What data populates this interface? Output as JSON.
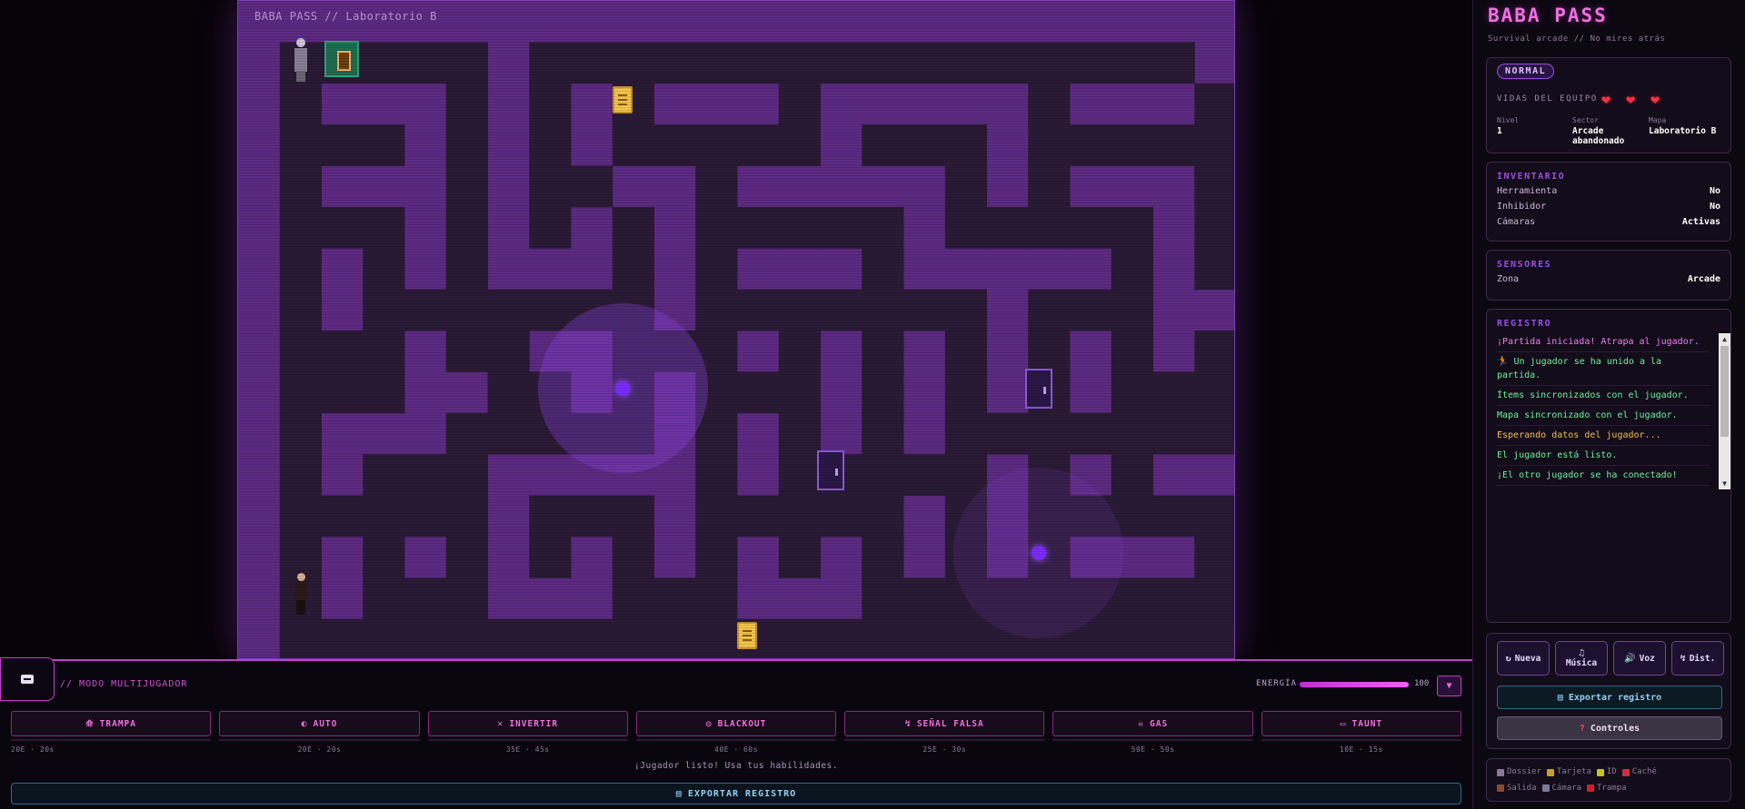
{
  "maze": {
    "title": "BABA PASS // Laboratorio B",
    "cols": 24,
    "rows": 16,
    "open_color": "#2a1a35",
    "wall_color": "#5c2a82",
    "open_cells": [
      [
        1,
        1
      ],
      [
        2,
        1
      ],
      [
        3,
        1
      ],
      [
        4,
        1
      ],
      [
        5,
        1
      ],
      [
        7,
        1
      ],
      [
        8,
        1
      ],
      [
        9,
        1
      ],
      [
        10,
        1
      ],
      [
        11,
        1
      ],
      [
        12,
        1
      ],
      [
        13,
        1
      ],
      [
        14,
        1
      ],
      [
        15,
        1
      ],
      [
        16,
        1
      ],
      [
        17,
        1
      ],
      [
        18,
        1
      ],
      [
        19,
        1
      ],
      [
        20,
        1
      ],
      [
        21,
        1
      ],
      [
        22,
        1
      ],
      [
        1,
        2
      ],
      [
        5,
        2
      ],
      [
        7,
        2
      ],
      [
        9,
        2
      ],
      [
        13,
        2
      ],
      [
        19,
        2
      ],
      [
        23,
        2
      ],
      [
        1,
        3
      ],
      [
        2,
        3
      ],
      [
        3,
        3
      ],
      [
        5,
        3
      ],
      [
        7,
        3
      ],
      [
        9,
        3
      ],
      [
        10,
        3
      ],
      [
        11,
        3
      ],
      [
        12,
        3
      ],
      [
        13,
        3
      ],
      [
        15,
        3
      ],
      [
        16,
        3
      ],
      [
        17,
        3
      ],
      [
        19,
        3
      ],
      [
        20,
        3
      ],
      [
        21,
        3
      ],
      [
        22,
        3
      ],
      [
        23,
        3
      ],
      [
        1,
        4
      ],
      [
        5,
        4
      ],
      [
        7,
        4
      ],
      [
        8,
        4
      ],
      [
        11,
        4
      ],
      [
        17,
        4
      ],
      [
        19,
        4
      ],
      [
        23,
        4
      ],
      [
        1,
        5
      ],
      [
        2,
        5
      ],
      [
        3,
        5
      ],
      [
        5,
        5
      ],
      [
        7,
        5
      ],
      [
        9,
        5
      ],
      [
        11,
        5
      ],
      [
        12,
        5
      ],
      [
        13,
        5
      ],
      [
        14,
        5
      ],
      [
        15,
        5
      ],
      [
        17,
        5
      ],
      [
        18,
        5
      ],
      [
        19,
        5
      ],
      [
        20,
        5
      ],
      [
        21,
        5
      ],
      [
        23,
        5
      ],
      [
        1,
        6
      ],
      [
        3,
        6
      ],
      [
        5,
        6
      ],
      [
        9,
        6
      ],
      [
        11,
        6
      ],
      [
        15,
        6
      ],
      [
        21,
        6
      ],
      [
        23,
        6
      ],
      [
        1,
        7
      ],
      [
        3,
        7
      ],
      [
        4,
        7
      ],
      [
        5,
        7
      ],
      [
        6,
        7
      ],
      [
        7,
        7
      ],
      [
        8,
        7
      ],
      [
        9,
        7
      ],
      [
        11,
        7
      ],
      [
        12,
        7
      ],
      [
        13,
        7
      ],
      [
        14,
        7
      ],
      [
        15,
        7
      ],
      [
        16,
        7
      ],
      [
        17,
        7
      ],
      [
        19,
        7
      ],
      [
        20,
        7
      ],
      [
        21,
        7
      ],
      [
        1,
        8
      ],
      [
        2,
        8
      ],
      [
        3,
        8
      ],
      [
        5,
        8
      ],
      [
        6,
        8
      ],
      [
        9,
        8
      ],
      [
        10,
        8
      ],
      [
        11,
        8
      ],
      [
        13,
        8
      ],
      [
        15,
        8
      ],
      [
        17,
        8
      ],
      [
        19,
        8
      ],
      [
        21,
        8
      ],
      [
        23,
        8
      ],
      [
        1,
        9
      ],
      [
        2,
        9
      ],
      [
        3,
        9
      ],
      [
        6,
        9
      ],
      [
        7,
        9
      ],
      [
        9,
        9
      ],
      [
        11,
        9
      ],
      [
        12,
        9
      ],
      [
        13,
        9
      ],
      [
        15,
        9
      ],
      [
        17,
        9
      ],
      [
        19,
        9
      ],
      [
        21,
        9
      ],
      [
        22,
        9
      ],
      [
        23,
        9
      ],
      [
        1,
        10
      ],
      [
        5,
        10
      ],
      [
        6,
        10
      ],
      [
        7,
        10
      ],
      [
        8,
        10
      ],
      [
        9,
        10
      ],
      [
        11,
        10
      ],
      [
        13,
        10
      ],
      [
        15,
        10
      ],
      [
        17,
        10
      ],
      [
        18,
        10
      ],
      [
        19,
        10
      ],
      [
        20,
        10
      ],
      [
        21,
        10
      ],
      [
        22,
        10
      ],
      [
        23,
        10
      ],
      [
        1,
        11
      ],
      [
        3,
        11
      ],
      [
        4,
        11
      ],
      [
        5,
        11
      ],
      [
        11,
        11
      ],
      [
        13,
        11
      ],
      [
        14,
        11
      ],
      [
        15,
        11
      ],
      [
        16,
        11
      ],
      [
        17,
        11
      ],
      [
        19,
        11
      ],
      [
        21,
        11
      ],
      [
        1,
        12
      ],
      [
        2,
        12
      ],
      [
        3,
        12
      ],
      [
        4,
        12
      ],
      [
        5,
        12
      ],
      [
        7,
        12
      ],
      [
        8,
        12
      ],
      [
        9,
        12
      ],
      [
        11,
        12
      ],
      [
        12,
        12
      ],
      [
        13,
        12
      ],
      [
        14,
        12
      ],
      [
        15,
        12
      ],
      [
        17,
        12
      ],
      [
        19,
        12
      ],
      [
        20,
        12
      ],
      [
        21,
        12
      ],
      [
        22,
        12
      ],
      [
        23,
        12
      ],
      [
        1,
        13
      ],
      [
        3,
        13
      ],
      [
        5,
        13
      ],
      [
        7,
        13
      ],
      [
        9,
        13
      ],
      [
        11,
        13
      ],
      [
        13,
        13
      ],
      [
        15,
        13
      ],
      [
        17,
        13
      ],
      [
        19,
        13
      ],
      [
        23,
        13
      ],
      [
        1,
        14
      ],
      [
        3,
        14
      ],
      [
        4,
        14
      ],
      [
        5,
        14
      ],
      [
        9,
        14
      ],
      [
        10,
        14
      ],
      [
        11,
        14
      ],
      [
        15,
        14
      ],
      [
        16,
        14
      ],
      [
        17,
        14
      ],
      [
        18,
        14
      ],
      [
        19,
        14
      ],
      [
        20,
        14
      ],
      [
        21,
        14
      ],
      [
        22,
        14
      ],
      [
        23,
        14
      ],
      [
        1,
        15
      ],
      [
        2,
        15
      ],
      [
        3,
        15
      ],
      [
        4,
        15
      ],
      [
        5,
        15
      ],
      [
        6,
        15
      ],
      [
        7,
        15
      ],
      [
        8,
        15
      ],
      [
        9,
        15
      ],
      [
        10,
        15
      ],
      [
        11,
        15
      ],
      [
        12,
        15
      ],
      [
        13,
        15
      ],
      [
        14,
        15
      ],
      [
        15,
        15
      ],
      [
        16,
        15
      ],
      [
        17,
        15
      ],
      [
        18,
        15
      ],
      [
        19,
        15
      ],
      [
        20,
        15
      ],
      [
        21,
        15
      ],
      [
        22,
        15
      ],
      [
        23,
        15
      ]
    ],
    "camera_zones": [
      {
        "x": 9.25,
        "y": 9.4,
        "r": 3.1,
        "faint": false
      },
      {
        "x": 19.25,
        "y": 13.4,
        "r": 3.1,
        "faint": true
      }
    ],
    "cameras": [
      {
        "x": 9.25,
        "y": 9.4
      },
      {
        "x": 19.25,
        "y": 13.4
      }
    ],
    "notes": [
      {
        "x": 9.25,
        "y": 2.4
      },
      {
        "x": 12.25,
        "y": 15.4
      }
    ],
    "doors": [
      {
        "x": 19.25,
        "y": 9.4
      },
      {
        "x": 14.25,
        "y": 11.4
      }
    ],
    "exit": {
      "x": 2.5,
      "y": 1.4
    },
    "ghost": {
      "x": 1.5,
      "y": 1.4
    },
    "player": {
      "x": 1.5,
      "y": 14.4
    }
  },
  "hud": {
    "mode_label": "// MODO MULTIJUGADOR",
    "energy_label": "ENERGÍA",
    "energy_value": 100,
    "energy_text": "100",
    "collapse_icon": "▼",
    "abilities": [
      {
        "icon": "⟰",
        "label": "TRAMPA",
        "cost": "20E · 20s"
      },
      {
        "icon": "◐",
        "label": "AUTO",
        "cost": "20E · 20s"
      },
      {
        "icon": "✕",
        "label": "INVERTIR",
        "cost": "35E · 45s"
      },
      {
        "icon": "◎",
        "label": "BLACKOUT",
        "cost": "40E · 60s"
      },
      {
        "icon": "↯",
        "label": "SEÑAL FALSA",
        "cost": "25E · 30s"
      },
      {
        "icon": "☠",
        "label": "GAS",
        "cost": "50E · 50s"
      },
      {
        "icon": "▭",
        "label": "TAUNT",
        "cost": "10E · 15s"
      }
    ],
    "status": "¡Jugador listo! Usa tus habilidades.",
    "export_label": "EXPORTAR REGISTRO",
    "export_icon": "▤"
  },
  "panel": {
    "title": "BABA PASS",
    "subtitle": "Survival arcade // No mires atrás",
    "difficulty": "NORMAL",
    "lives_label": "VIDAS DEL EQUIPO",
    "lives": 3,
    "heart_icon": "❤",
    "stats": [
      {
        "key": "Nivel",
        "value": "1"
      },
      {
        "key": "Sector",
        "value": "Arcade abandonado"
      },
      {
        "key": "Mapa",
        "value": "Laboratorio B"
      }
    ],
    "inventory": {
      "title": "INVENTARIO",
      "rows": [
        {
          "key": "Herramienta",
          "value": "No"
        },
        {
          "key": "Inhibidor",
          "value": "No"
        },
        {
          "key": "Cámaras",
          "value": "Activas"
        }
      ]
    },
    "sensors": {
      "title": "SENSORES",
      "rows": [
        {
          "key": "Zona",
          "value": "Arcade"
        }
      ]
    },
    "log": {
      "title": "REGISTRO",
      "items": [
        {
          "text": "¡Partida iniciada! Atrapa al jugador.",
          "color": "#f080f0"
        },
        {
          "text": "🏃 Un jugador se ha unido a la partida.",
          "color": "#70f0a0"
        },
        {
          "text": "Ítems sincronizados con el jugador.",
          "color": "#70f0a0"
        },
        {
          "text": "Mapa sincronizado con el jugador.",
          "color": "#70f0a0"
        },
        {
          "text": "Esperando datos del jugador...",
          "color": "#f0c050"
        },
        {
          "text": "El jugador está listo.",
          "color": "#70f0a0"
        },
        {
          "text": "¡El otro jugador se ha conectado!",
          "color": "#70f0a0"
        }
      ]
    },
    "actions": [
      {
        "icon": "↻",
        "label": "Nueva"
      },
      {
        "icon": "♫",
        "label": "Música"
      },
      {
        "icon": "🔊",
        "label": "Voz"
      },
      {
        "icon": "↯",
        "label": "Dist."
      }
    ],
    "export_label": "Exportar registro",
    "export_icon": "▤",
    "controls_label": "Controles",
    "controls_icon": "?",
    "legend": [
      {
        "label": "Dossier",
        "color": "#8a7a96"
      },
      {
        "label": "Tarjeta",
        "color": "#c8a030"
      },
      {
        "label": "ID",
        "color": "#c8c020"
      },
      {
        "label": "Caché",
        "color": "#d03040"
      },
      {
        "label": "Salida",
        "color": "#8a4a30"
      },
      {
        "label": "Cámara",
        "color": "#7a7a9a"
      },
      {
        "label": "Trampa",
        "color": "#d02030"
      }
    ]
  }
}
